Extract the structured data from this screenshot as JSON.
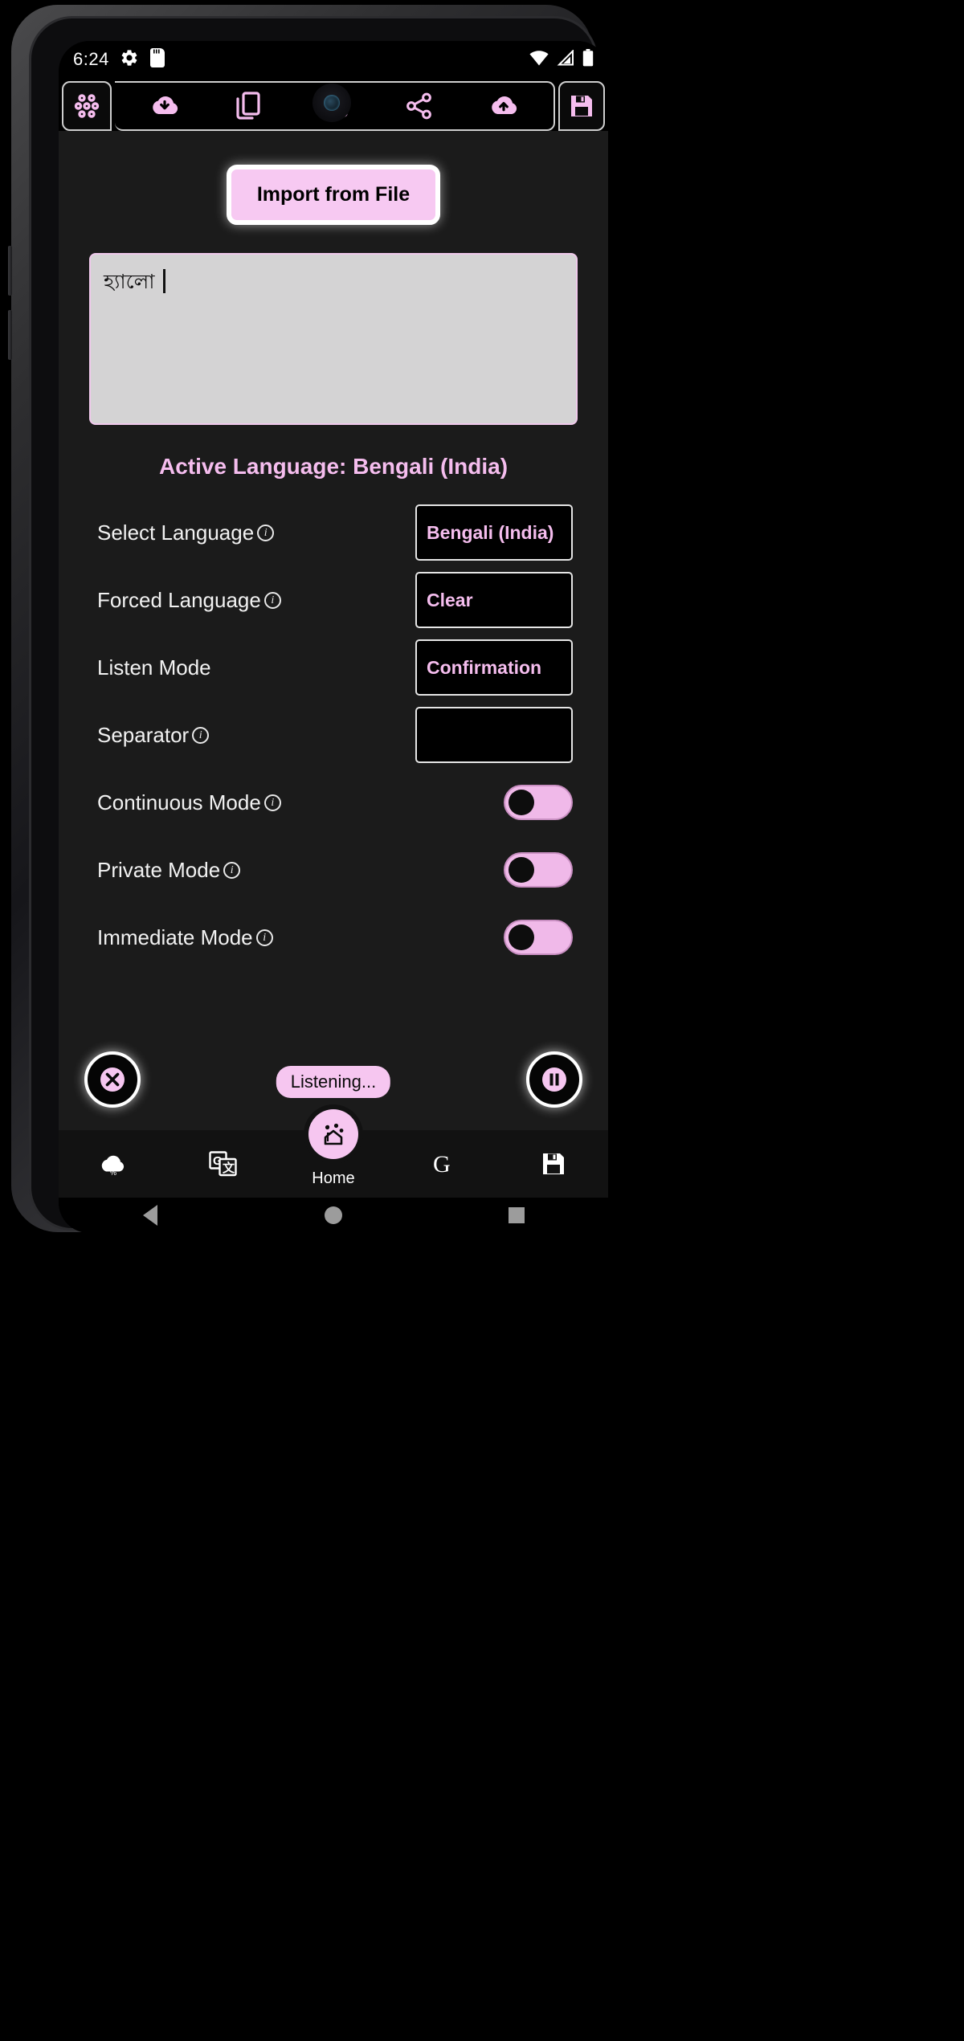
{
  "status_bar": {
    "time": "6:24",
    "left_icons": [
      "gear-icon",
      "sd-card-icon"
    ],
    "right_icons": [
      "wifi-icon",
      "signal-icon",
      "battery-icon"
    ]
  },
  "toolbar": {
    "menu_icon": "apps-grid-icon",
    "items": [
      {
        "icon": "cloud-download-icon",
        "name": "cloud-download"
      },
      {
        "icon": "duplicate-icon",
        "name": "duplicate"
      },
      {
        "icon": "robot-icon",
        "name": "robot"
      },
      {
        "icon": "share-icon",
        "name": "share"
      },
      {
        "icon": "cloud-upload-icon",
        "name": "cloud-upload"
      }
    ],
    "save_icon": "floppy-save-icon"
  },
  "main": {
    "import_button_label": "Import from File",
    "textarea_value": "হ্যালো",
    "textarea_placeholder": "",
    "active_language_heading": "Active Language: Bengali (India)"
  },
  "settings": [
    {
      "label": "Select Language",
      "has_info": true,
      "control": "value",
      "value": "Bengali (India)"
    },
    {
      "label": "Forced Language",
      "has_info": true,
      "control": "value",
      "value": "Clear"
    },
    {
      "label": "Listen Mode",
      "has_info": false,
      "control": "value",
      "value": "Confirmation"
    },
    {
      "label": "Separator",
      "has_info": true,
      "control": "value",
      "value": ""
    },
    {
      "label": "Continuous Mode",
      "has_info": true,
      "control": "toggle",
      "value": "off"
    },
    {
      "label": "Private Mode",
      "has_info": true,
      "control": "toggle",
      "value": "off"
    },
    {
      "label": "Immediate Mode",
      "has_info": true,
      "control": "toggle",
      "value": "off"
    }
  ],
  "actions": {
    "close_icon": "close-x-icon",
    "listening_label": "Listening...",
    "pause_icon": "pause-circle-icon"
  },
  "bottom_nav": {
    "items": [
      {
        "name": "weather",
        "icon": "cloud-weather-icon",
        "label": ""
      },
      {
        "name": "translate",
        "icon": "google-translate-icon",
        "label": ""
      },
      {
        "name": "home",
        "icon": "home-heart-icon",
        "label": "Home"
      },
      {
        "name": "google",
        "icon": "google-g-icon",
        "label": ""
      },
      {
        "name": "save",
        "icon": "floppy-save-icon",
        "label": ""
      }
    ]
  },
  "system_nav": {
    "back": "back-triangle-icon",
    "home": "home-circle-icon",
    "recents": "recents-square-icon"
  },
  "colors": {
    "accent_pink": "#f5bdee",
    "button_pink": "#f7c9f2",
    "app_bg": "#1b1b1b",
    "textarea_bg": "#d4d3d4"
  }
}
